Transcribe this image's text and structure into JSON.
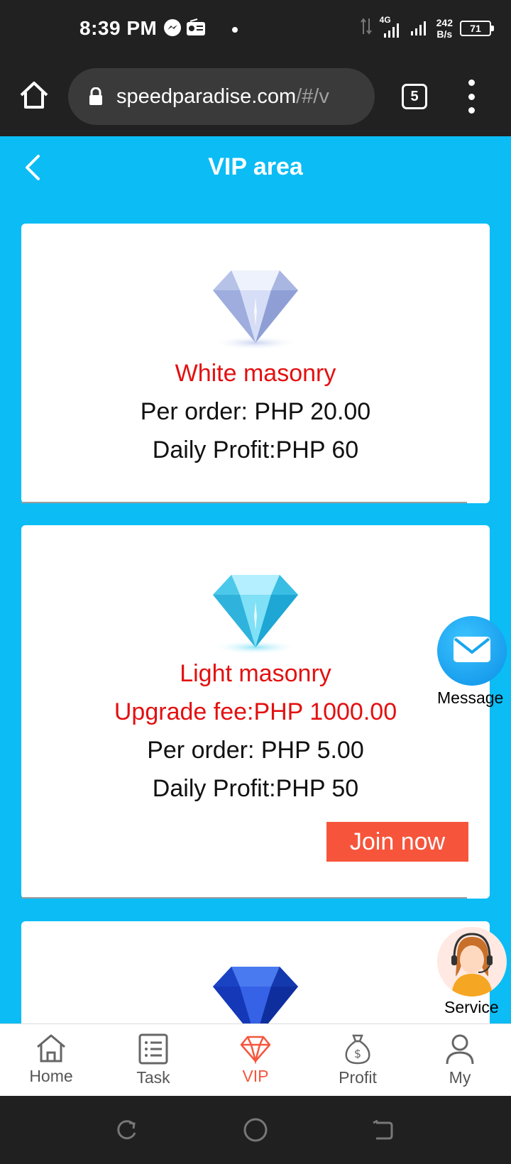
{
  "status_bar": {
    "time": "8:39 PM",
    "network": "4G",
    "speed_value": "242",
    "speed_unit": "B/s",
    "battery": "71"
  },
  "browser": {
    "url_main": "speedparadise.com",
    "url_rest": "/#/v",
    "tab_count": "5"
  },
  "header": {
    "title": "VIP area"
  },
  "cards": [
    {
      "name": "White masonry",
      "per_order": "Per order: PHP 20.00",
      "daily_profit": "Daily Profit:PHP 60"
    },
    {
      "name": "Light masonry",
      "upgrade_fee": "Upgrade fee:PHP 1000.00",
      "per_order": "Per order: PHP 5.00",
      "daily_profit": "Daily Profit:PHP 50",
      "join_label": "Join now"
    }
  ],
  "floating": {
    "message_label": "Message",
    "service_label": "Service"
  },
  "tabs": [
    {
      "label": "Home",
      "icon": "home-icon"
    },
    {
      "label": "Task",
      "icon": "task-list-icon"
    },
    {
      "label": "VIP",
      "icon": "diamond-icon"
    },
    {
      "label": "Profit",
      "icon": "money-bag-icon"
    },
    {
      "label": "My",
      "icon": "user-icon"
    }
  ],
  "colors": {
    "page_bg": "#0bbcf5",
    "accent": "#f6553c",
    "highlight_text": "#e31010",
    "status_bar_bg": "#212121"
  }
}
